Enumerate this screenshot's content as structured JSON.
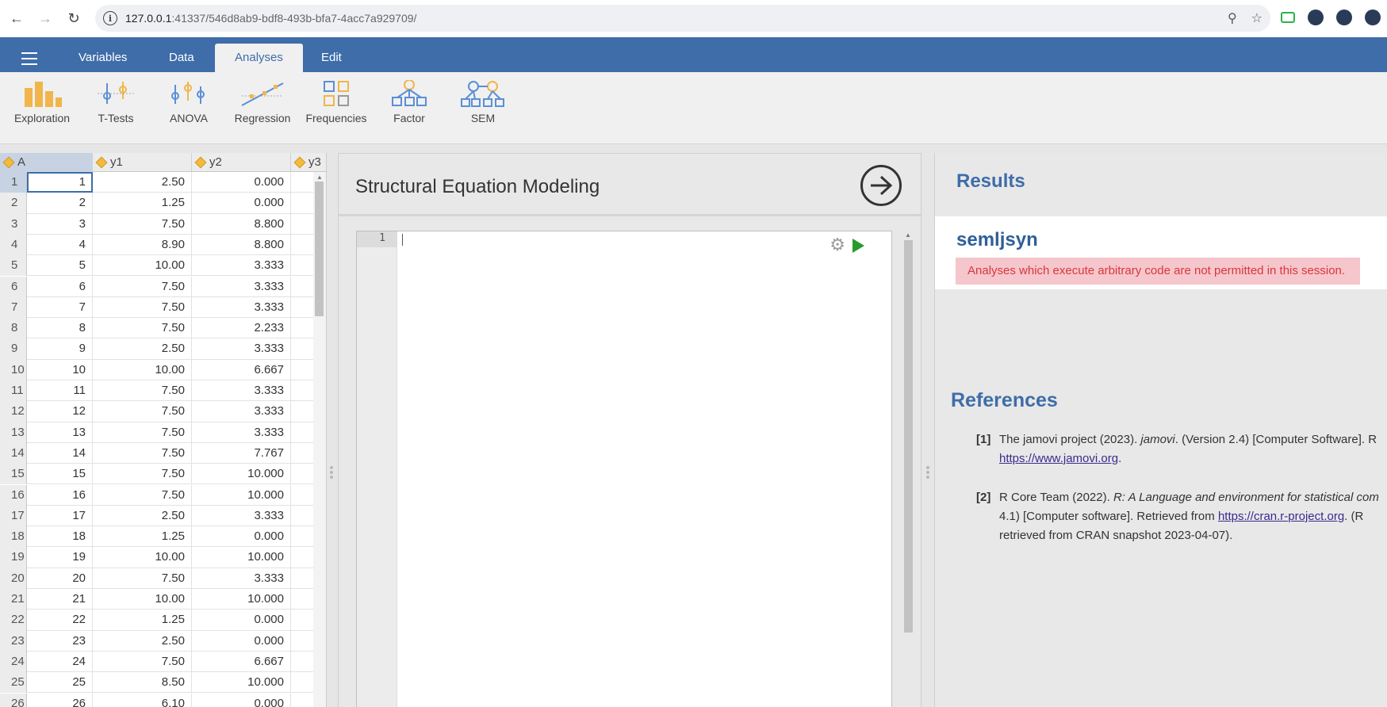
{
  "browser": {
    "url_host": "127.0.0.1",
    "url_path": ":41337/546d8ab9-bdf8-493b-bfa7-4acc7a929709/"
  },
  "ribbon": {
    "tabs": [
      "Variables",
      "Data",
      "Analyses",
      "Edit"
    ],
    "active_tab": "Analyses",
    "tools": [
      "Exploration",
      "T-Tests",
      "ANOVA",
      "Regression",
      "Frequencies",
      "Factor",
      "SEM"
    ]
  },
  "sheet": {
    "columns": [
      "A",
      "y1",
      "y2",
      "y3"
    ],
    "rows": [
      [
        "1",
        "1",
        "2.50",
        "0.000"
      ],
      [
        "2",
        "2",
        "1.25",
        "0.000"
      ],
      [
        "3",
        "3",
        "7.50",
        "8.800"
      ],
      [
        "4",
        "4",
        "8.90",
        "8.800"
      ],
      [
        "5",
        "5",
        "10.00",
        "3.333"
      ],
      [
        "6",
        "6",
        "7.50",
        "3.333"
      ],
      [
        "7",
        "7",
        "7.50",
        "3.333"
      ],
      [
        "8",
        "8",
        "7.50",
        "2.233"
      ],
      [
        "9",
        "9",
        "2.50",
        "3.333"
      ],
      [
        "10",
        "10",
        "10.00",
        "6.667"
      ],
      [
        "11",
        "11",
        "7.50",
        "3.333"
      ],
      [
        "12",
        "12",
        "7.50",
        "3.333"
      ],
      [
        "13",
        "13",
        "7.50",
        "3.333"
      ],
      [
        "14",
        "14",
        "7.50",
        "7.767"
      ],
      [
        "15",
        "15",
        "7.50",
        "10.000"
      ],
      [
        "16",
        "16",
        "7.50",
        "10.000"
      ],
      [
        "17",
        "17",
        "2.50",
        "3.333"
      ],
      [
        "18",
        "18",
        "1.25",
        "0.000"
      ],
      [
        "19",
        "19",
        "10.00",
        "10.000"
      ],
      [
        "20",
        "20",
        "7.50",
        "3.333"
      ],
      [
        "21",
        "21",
        "10.00",
        "10.000"
      ],
      [
        "22",
        "22",
        "1.25",
        "0.000"
      ],
      [
        "23",
        "23",
        "2.50",
        "0.000"
      ],
      [
        "24",
        "24",
        "7.50",
        "6.667"
      ],
      [
        "25",
        "25",
        "8.50",
        "10.000"
      ],
      [
        "26",
        "26",
        "6.10",
        "0.000"
      ]
    ]
  },
  "analysis": {
    "title": "Structural Equation Modeling",
    "editor_line_number": "1"
  },
  "results": {
    "title": "Results",
    "analysis_name": "semljsyn",
    "error": "Analyses which execute arbitrary code are not permitted in this session.",
    "references_title": "References",
    "refs": [
      {
        "num": "[1]",
        "line1_pre": "The jamovi project (2023). ",
        "line1_italic": "jamovi",
        "line1_post": ". (Version 2.4) [Computer Software]. R",
        "link": "https://www.jamovi.org",
        "line2_post": "."
      },
      {
        "num": "[2]",
        "line1_pre": "R Core Team (2022). ",
        "line1_italic": "R: A Language and environment for statistical com",
        "line2_pre": "4.1) [Computer software]. Retrieved from ",
        "link": "https://cran.r-project.org",
        "line2_post": ". (R",
        "line3": "retrieved from CRAN snapshot 2023-04-07)."
      }
    ]
  },
  "colors": {
    "brand": "#3e6da9",
    "error_bg": "#f5c6cb",
    "error_text": "#d9363e",
    "run": "#2a9a2a"
  }
}
